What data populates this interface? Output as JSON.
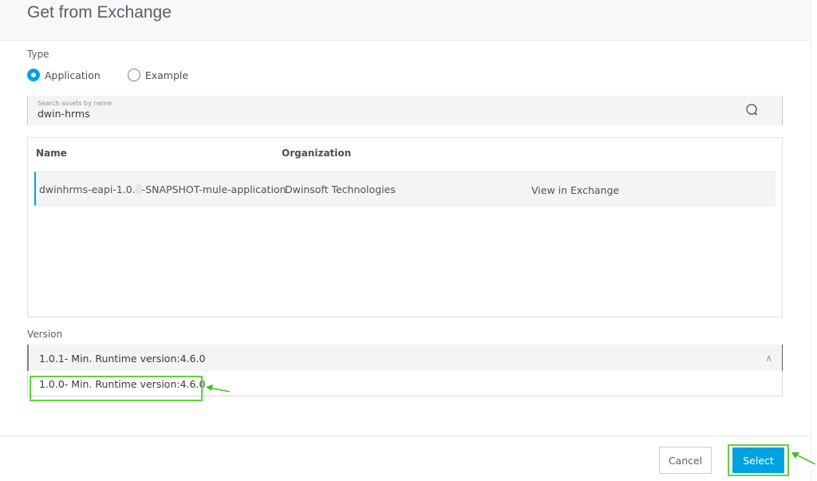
{
  "dialog": {
    "title": "Get from Exchange"
  },
  "type": {
    "label": "Type",
    "options": [
      {
        "label": "Application",
        "selected": true
      },
      {
        "label": "Example",
        "selected": false
      }
    ]
  },
  "search": {
    "placeholder": "Search assets by name",
    "value": "dwin-hrms",
    "icon": "search-icon"
  },
  "table": {
    "columns": [
      "Name",
      "Organization"
    ],
    "rows": [
      {
        "name_prefix": "dwinhrms-eapi-1.0.",
        "name_suffix": "-SNAPSHOT-mule-application",
        "organization": "Dwinsoft Technologies",
        "link": "View in Exchange"
      }
    ]
  },
  "version": {
    "label": "Version",
    "selected": "1.0.1- Min. Runtime version:4.6.0",
    "options": [
      "1.0.0- Min. Runtime version:4.6.0"
    ],
    "expanded": true,
    "chevron_icon": "chevron-up-icon"
  },
  "footer": {
    "cancel_label": "Cancel",
    "select_label": "Select"
  },
  "colors": {
    "accent": "#00a2df",
    "annotation": "#5fd23c"
  }
}
